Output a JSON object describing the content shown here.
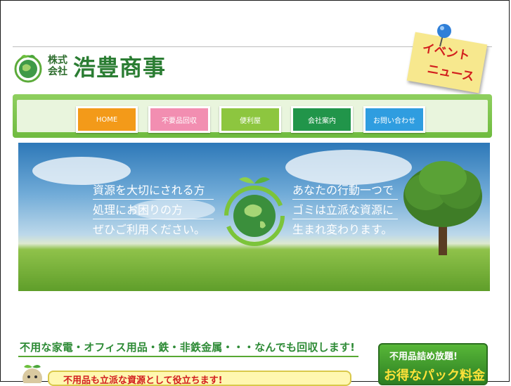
{
  "header": {
    "company_small_line1": "株式",
    "company_small_line2": "会社",
    "company_name": "浩豊商事",
    "event_note_line1": "イベント",
    "event_note_line2": "ニュース"
  },
  "nav": {
    "items": [
      {
        "label": "HOME",
        "color": "#f39a19"
      },
      {
        "label": "不要品回収",
        "color": "#f28eb1"
      },
      {
        "label": "便利屋",
        "color": "#8dc63f"
      },
      {
        "label": "会社案内",
        "color": "#21954a"
      },
      {
        "label": "お問い合わせ",
        "color": "#2f9de0"
      }
    ]
  },
  "hero": {
    "left_lines": [
      "資源を大切にされる方",
      "処理にお困りの方",
      "ぜひご利用ください。"
    ],
    "right_lines": [
      "あなたの行動一つで",
      "ゴミは立派な資源に",
      "生まれ変わります。"
    ]
  },
  "content": {
    "tagline": "不用な家電・オフィス用品・鉄・非鉄金属・・・なんでも回収します!",
    "subbar": "不用品も立派な資源として役立ちます!",
    "promo_line1": "不用品詰め放題!",
    "promo_line2": "お得なパック料金"
  },
  "colors": {
    "brand_green": "#2b7d33",
    "accent_red": "#d21d1d"
  }
}
